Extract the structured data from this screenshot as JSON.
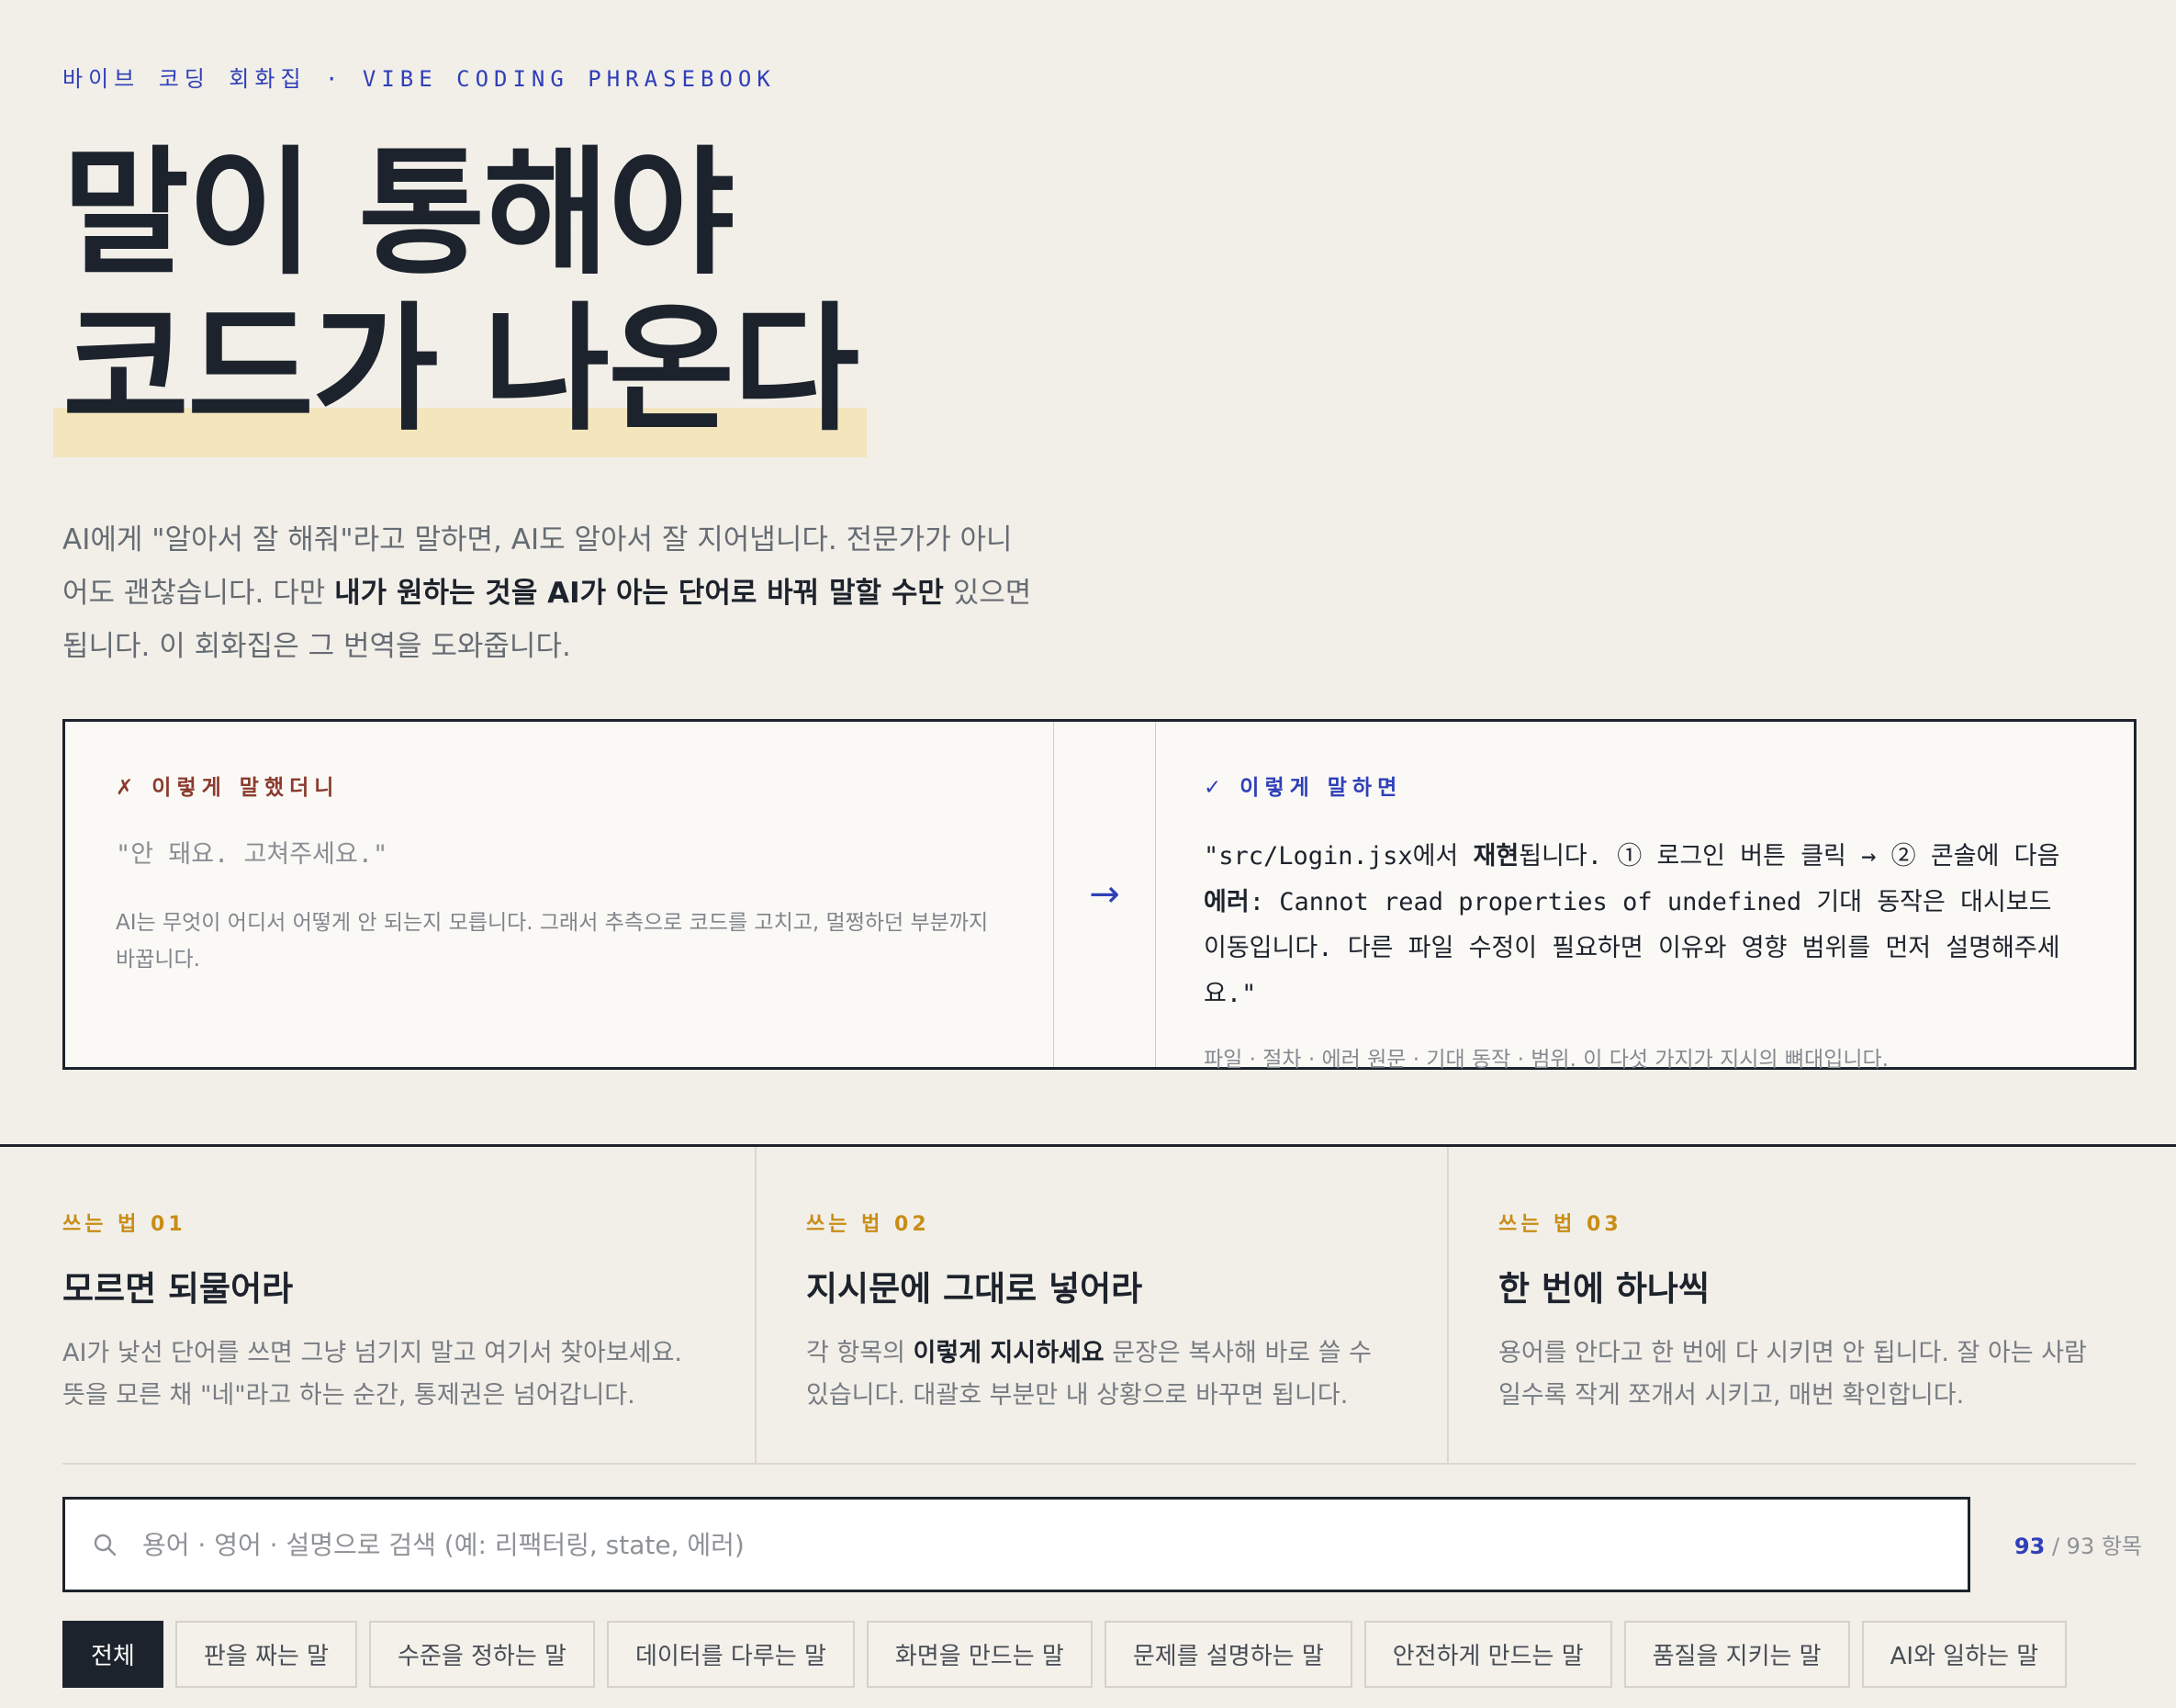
{
  "header": {
    "kicker": "바이브 코딩 회화집 · VIBE CODING PHRASEBOOK",
    "title_line1": "말이 통해야",
    "title_line2": "코드가 나온다",
    "lead_1": "AI에게 \"알아서 잘 해줘\"라고 말하면, AI도 알아서 잘 지어냅니다. 전문가가 아니어도 괜찮습니다. 다만 ",
    "lead_strong": "내가 원하는 것을 AI가 아는 단어로 바꿔 말할 수만",
    "lead_2": " 있으면 됩니다. 이 회화집은 그 번역을 도와줍니다."
  },
  "compare": {
    "bad": {
      "label": "✗ 이렇게 말했더니",
      "quote": "\"안 돼요. 고쳐주세요.\"",
      "desc": "AI는 무엇이 어디서 어떻게 안 되는지 모릅니다. 그래서 추측으로 코드를 고치고, 멀쩡하던 부분까지 바꿉니다."
    },
    "arrow": "→",
    "good": {
      "label": "✓ 이렇게 말하면",
      "quote_1": "\"src/Login.jsx에서 ",
      "quote_b1": "재현",
      "quote_2": "됩니다. ① 로그인 버튼 클릭 → ② 콘솔에 다음 ",
      "quote_b2": "에러",
      "quote_3": ": Cannot read properties of undefined 기대 동작은 대시보드 이동입니다. 다른 파일 수정이 필요하면 이유와 영향 범위를 먼저 설명해주세요.\"",
      "note": "파일 · 절차 · 에러 원문 · 기대 동작 · 범위. 이 다섯 가지가 지시의 뼈대입니다."
    }
  },
  "tips": [
    {
      "num": "쓰는 법 01",
      "title": "모르면 되물어라",
      "desc": "AI가 낯선 단어를 쓰면 그냥 넘기지 말고 여기서 찾아보세요. 뜻을 모른 채 \"네\"라고 하는 순간, 통제권은 넘어갑니다."
    },
    {
      "num": "쓰는 법 02",
      "title": "지시문에 그대로 넣어라",
      "desc_1": "각 항목의 ",
      "desc_b": "이렇게 지시하세요",
      "desc_2": " 문장은 복사해 바로 쓸 수 있습니다. 대괄호 부분만 내 상황으로 바꾸면 됩니다."
    },
    {
      "num": "쓰는 법 03",
      "title": "한 번에 하나씩",
      "desc": "용어를 안다고 한 번에 다 시키면 안 됩니다. 잘 아는 사람일수록 작게 쪼개서 시키고, 매번 확인합니다."
    }
  ],
  "search": {
    "placeholder": "용어 · 영어 · 설명으로 검색 (예: 리팩터링, state, 에러)",
    "value": ""
  },
  "count": {
    "shown": "93",
    "sep": " / ",
    "total": "93 항목"
  },
  "chips": [
    "전체",
    "판을 짜는 말",
    "수준을 정하는 말",
    "데이터를 다루는 말",
    "화면을 만드는 말",
    "문제를 설명하는 말",
    "안전하게 만드는 말",
    "품질을 지키는 말",
    "AI와 일하는 말"
  ],
  "colors": {
    "accent": "#2f3fb8",
    "ink": "#1d232c",
    "highlight": "#f3e6bd",
    "tip": "#c98d16",
    "bad": "#8b3a2e"
  }
}
